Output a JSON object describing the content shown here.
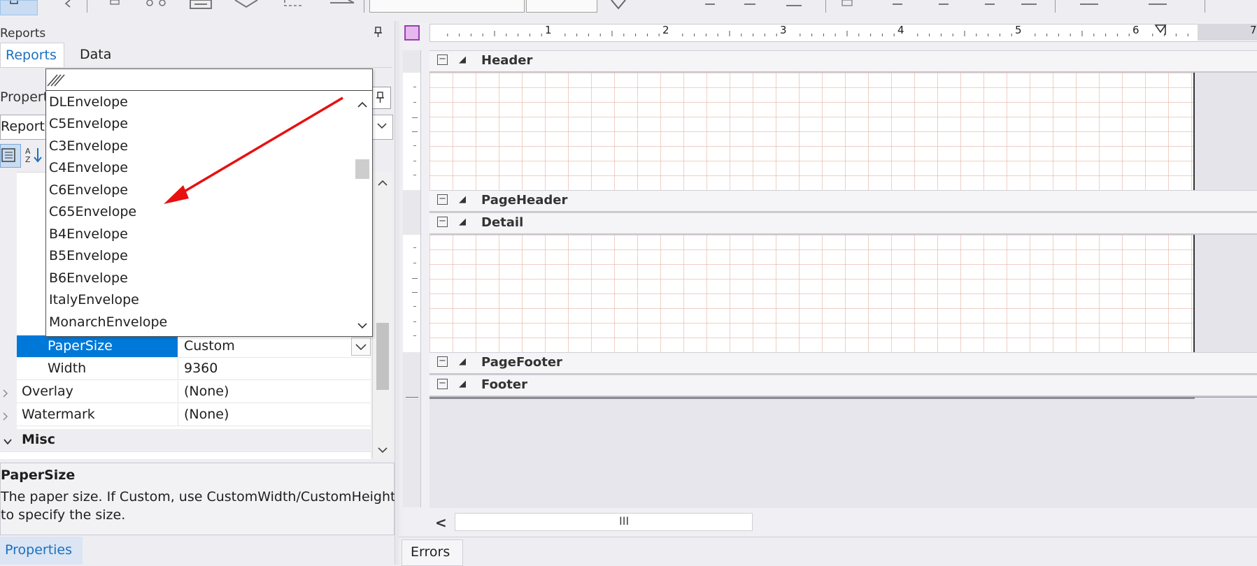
{
  "toolbar": {
    "icons": [
      "window-icon",
      "undo-icon",
      "copy-icon",
      "cut-icon",
      "paste-icon",
      "delete-icon",
      "redo-icon",
      "arrow-icon",
      "text-icon",
      "align-icon",
      "format-icon"
    ]
  },
  "left_panel": {
    "reports_window_title": "Reports",
    "pin_glyph": "❑",
    "tabs": [
      {
        "label": "Reports"
      },
      {
        "label": "Data"
      }
    ],
    "properties_window_title": "Propert",
    "object_selector_value": "Report",
    "dropdown": {
      "items": [
        "DLEnvelope",
        "C5Envelope",
        "C3Envelope",
        "C4Envelope",
        "C6Envelope",
        "C65Envelope",
        "B4Envelope",
        "B5Envelope",
        "B6Envelope",
        "ItalyEnvelope",
        "MonarchEnvelope"
      ]
    },
    "grid_rows": [
      {
        "name": "PaperSize",
        "value": "Custom",
        "selected": true
      },
      {
        "name": "Width",
        "value": "9360",
        "selected": false
      },
      {
        "name": "Overlay",
        "value": "(None)",
        "selected": false,
        "expandable": true
      },
      {
        "name": "Watermark",
        "value": "(None)",
        "selected": false,
        "expandable": true
      }
    ],
    "category": {
      "name": "Misc"
    },
    "description": {
      "title": "PaperSize",
      "text_line1": "The paper size. If Custom, use CustomWidth/CustomHeight",
      "text_line2": "to specify the size."
    },
    "bottom_tab": "Properties"
  },
  "designer": {
    "ruler_numbers": [
      "1",
      "2",
      "3",
      "4",
      "5",
      "6",
      "7"
    ],
    "bands": [
      {
        "label": "Header"
      },
      {
        "label": "PageHeader"
      },
      {
        "label": "Detail"
      },
      {
        "label": "PageFooter"
      },
      {
        "label": "Footer"
      }
    ],
    "scroll_thumb_glyph": "III",
    "scroll_left_glyph": "<",
    "bottom_tab": "Errors"
  },
  "colors": {
    "selection": "#0078d7",
    "accent_text": "#1c6fc0",
    "annotation_arrow": "#e81010",
    "grid": "#e2aa96"
  }
}
